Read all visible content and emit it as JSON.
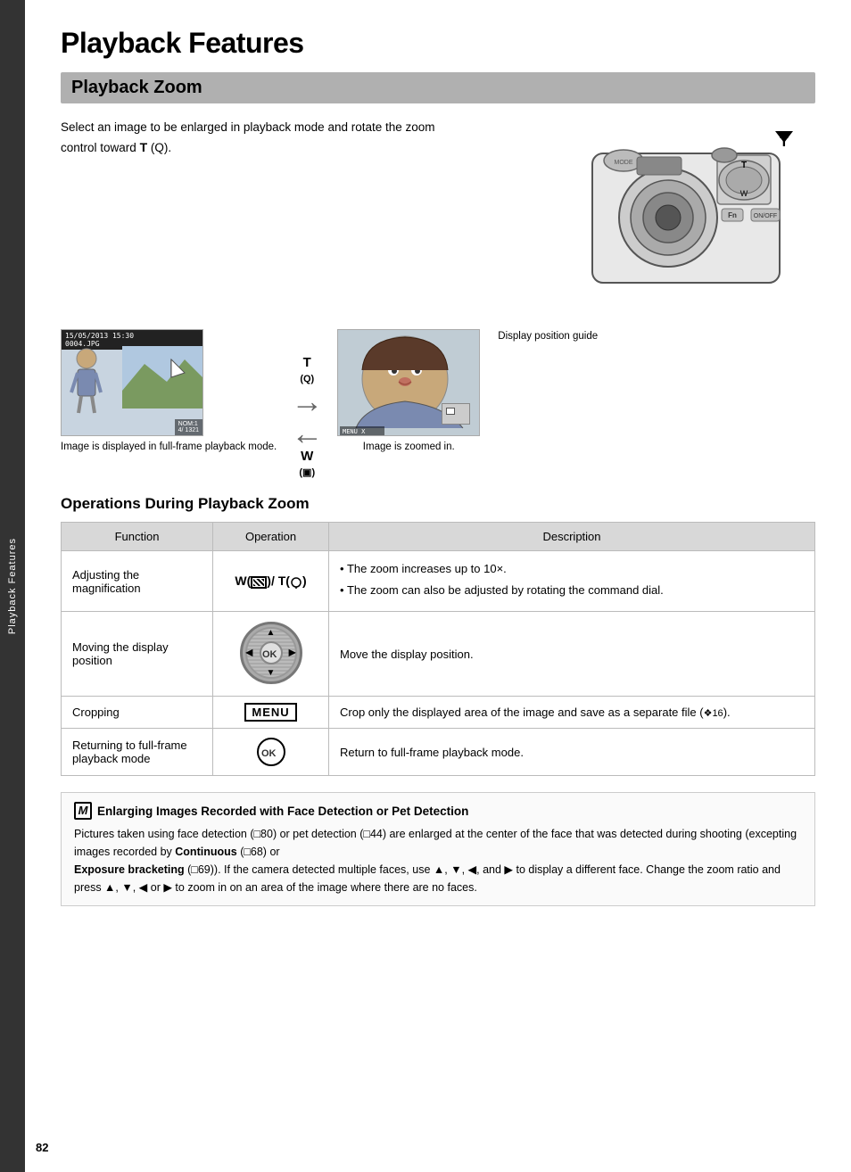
{
  "page": {
    "title": "Playback Features",
    "number": "82",
    "sidebar_label": "Playback Features"
  },
  "section": {
    "title": "Playback Zoom",
    "intro": "Select an image to be enlarged in playback mode and rotate the zoom control toward",
    "bold_T": "T",
    "paren": "(Q).",
    "images": {
      "full_frame_label": "Image is displayed in full-frame playback mode.",
      "zoomed_label": "Image is zoomed in.",
      "display_guide_label": "Display position guide",
      "screen_header": "15/05/2013 15:30\n0004.JPG",
      "screen_footer": "NOM:1\n4/ 1321",
      "arrow_T": "T",
      "arrow_T_sub": "(Q)",
      "arrow_W": "W",
      "arrow_W_sub": "(▣)"
    }
  },
  "operations": {
    "title": "Operations During Playback Zoom",
    "columns": {
      "function": "Function",
      "operation": "Operation",
      "description": "Description"
    },
    "rows": [
      {
        "function": "Adjusting the magnification",
        "operation_label": "W(▣)/ T(Q)",
        "description_items": [
          "The zoom increases up to 10×.",
          "The zoom can also be adjusted by rotating the command dial."
        ]
      },
      {
        "function": "Moving the display position",
        "operation_label": "dpad_ok",
        "description": "Move the display position."
      },
      {
        "function": "Cropping",
        "operation_label": "MENU",
        "description": "Crop only the displayed area of the image and save as a separate file (❖16)."
      },
      {
        "function": "Returning to full-frame playback mode",
        "operation_label": "ok_only",
        "description": "Return to full-frame playback mode."
      }
    ]
  },
  "note": {
    "icon": "M",
    "title": "Enlarging Images Recorded with Face Detection or Pet Detection",
    "body": "Pictures taken using face detection (□80) or pet detection (□44) are enlarged at the center of the face that was detected during shooting (excepting images recorded by",
    "bold1": "Continuous",
    "body2": "(□68) or",
    "bold2": "Exposure bracketing",
    "body3": "(□69)). If the camera detected multiple faces, use ▲, ▼, ◀, and ▶ to display a different face. Change the zoom ratio and press ▲, ▼, ◀ or ▶ to zoom in on an area of the image where there are no faces."
  }
}
